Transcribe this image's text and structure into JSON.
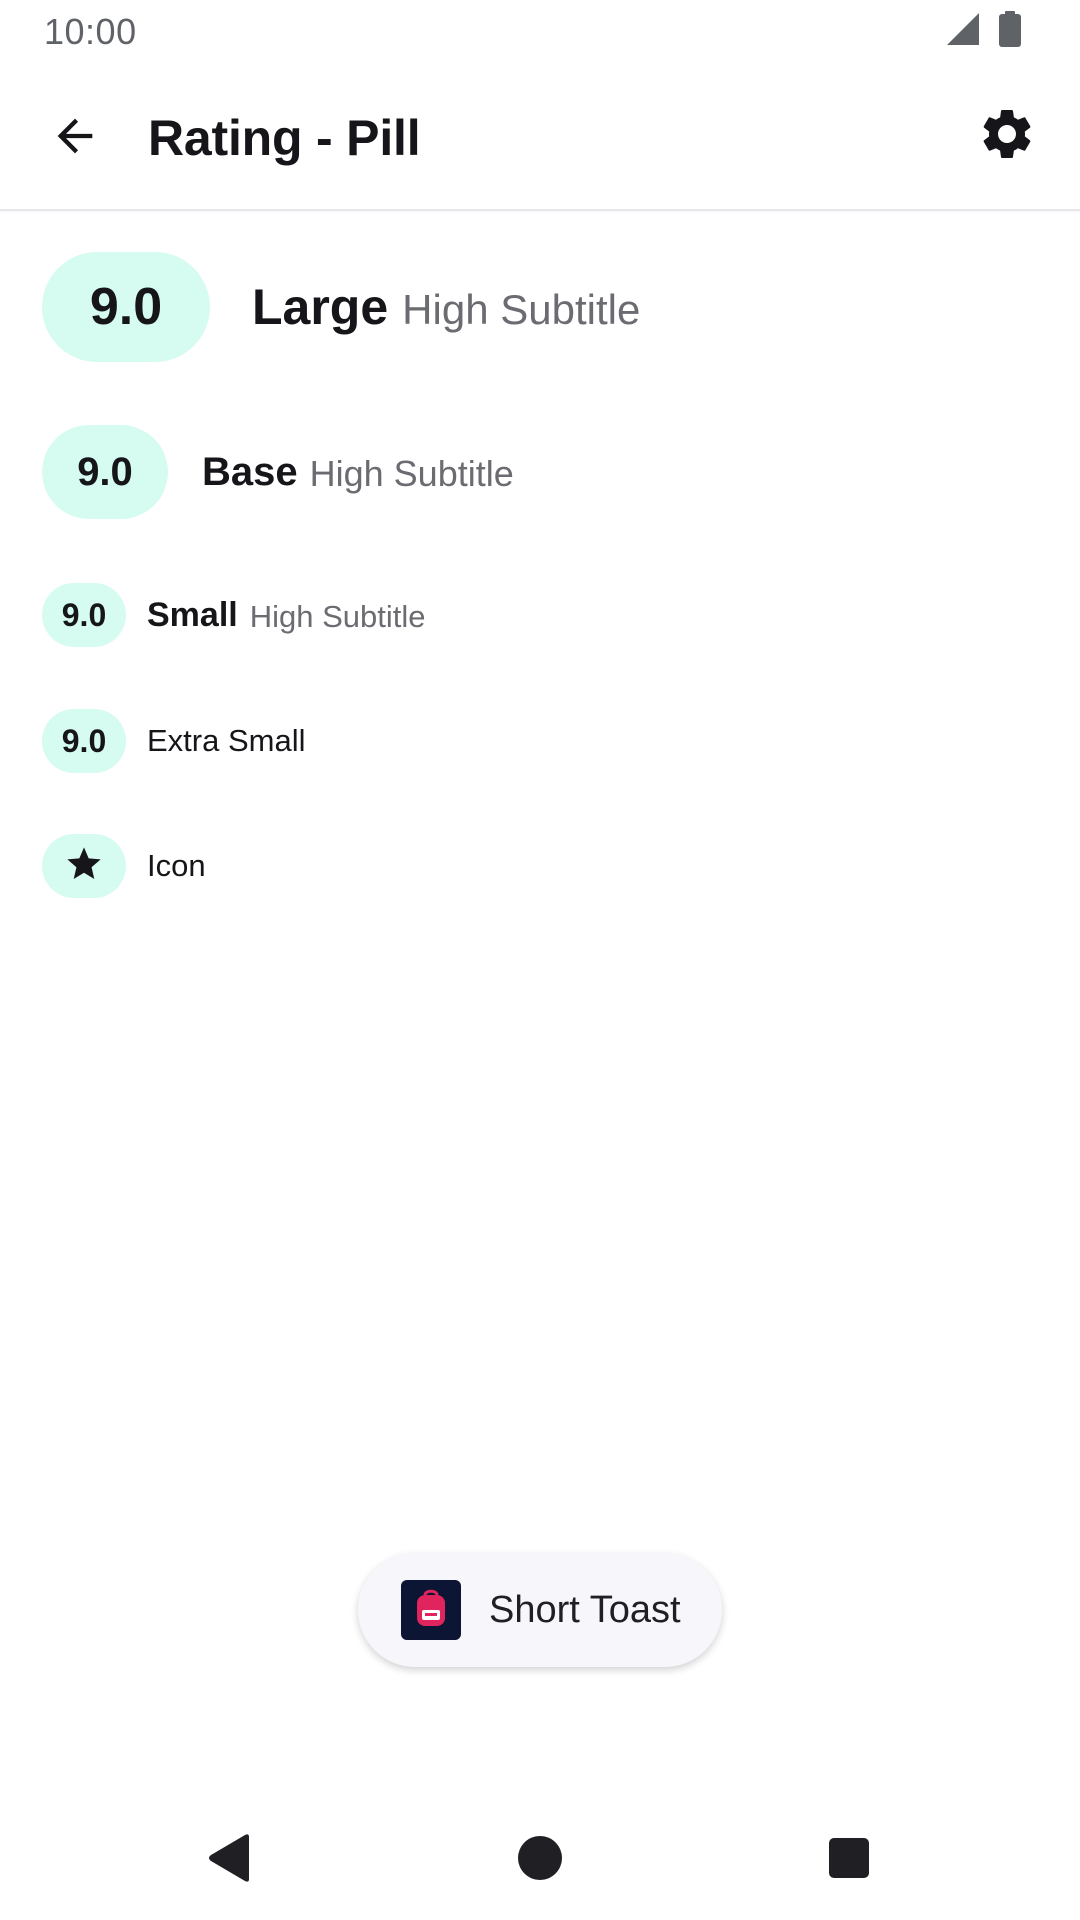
{
  "status_bar": {
    "time": "10:00",
    "icons": [
      "signal-icon",
      "battery-icon"
    ]
  },
  "app_bar": {
    "title": "Rating - Pill",
    "back_icon": "arrow-back-icon",
    "settings_icon": "gear-icon"
  },
  "ratings": {
    "large": {
      "value": "9.0",
      "title": "Large",
      "subtitle": "High Subtitle"
    },
    "base": {
      "value": "9.0",
      "title": "Base",
      "subtitle": "High Subtitle"
    },
    "small": {
      "value": "9.0",
      "title": "Small",
      "subtitle": "High Subtitle"
    },
    "extra_small": {
      "value": "9.0",
      "label": "Extra Small"
    },
    "icon": {
      "icon": "star-icon",
      "label": "Icon"
    }
  },
  "toast": {
    "text": "Short Toast",
    "icon": "backpack-icon"
  },
  "nav_bar": {
    "buttons": [
      "back-triangle-icon",
      "home-circle-icon",
      "recents-square-icon"
    ]
  },
  "colors": {
    "pill_background": "#d6fbf0",
    "text_primary": "#16161a",
    "text_secondary": "#6b6b72",
    "toast_background": "#f7f7fb",
    "toast_icon_background": "#0c1533",
    "toast_icon_accent": "#e0245e"
  }
}
